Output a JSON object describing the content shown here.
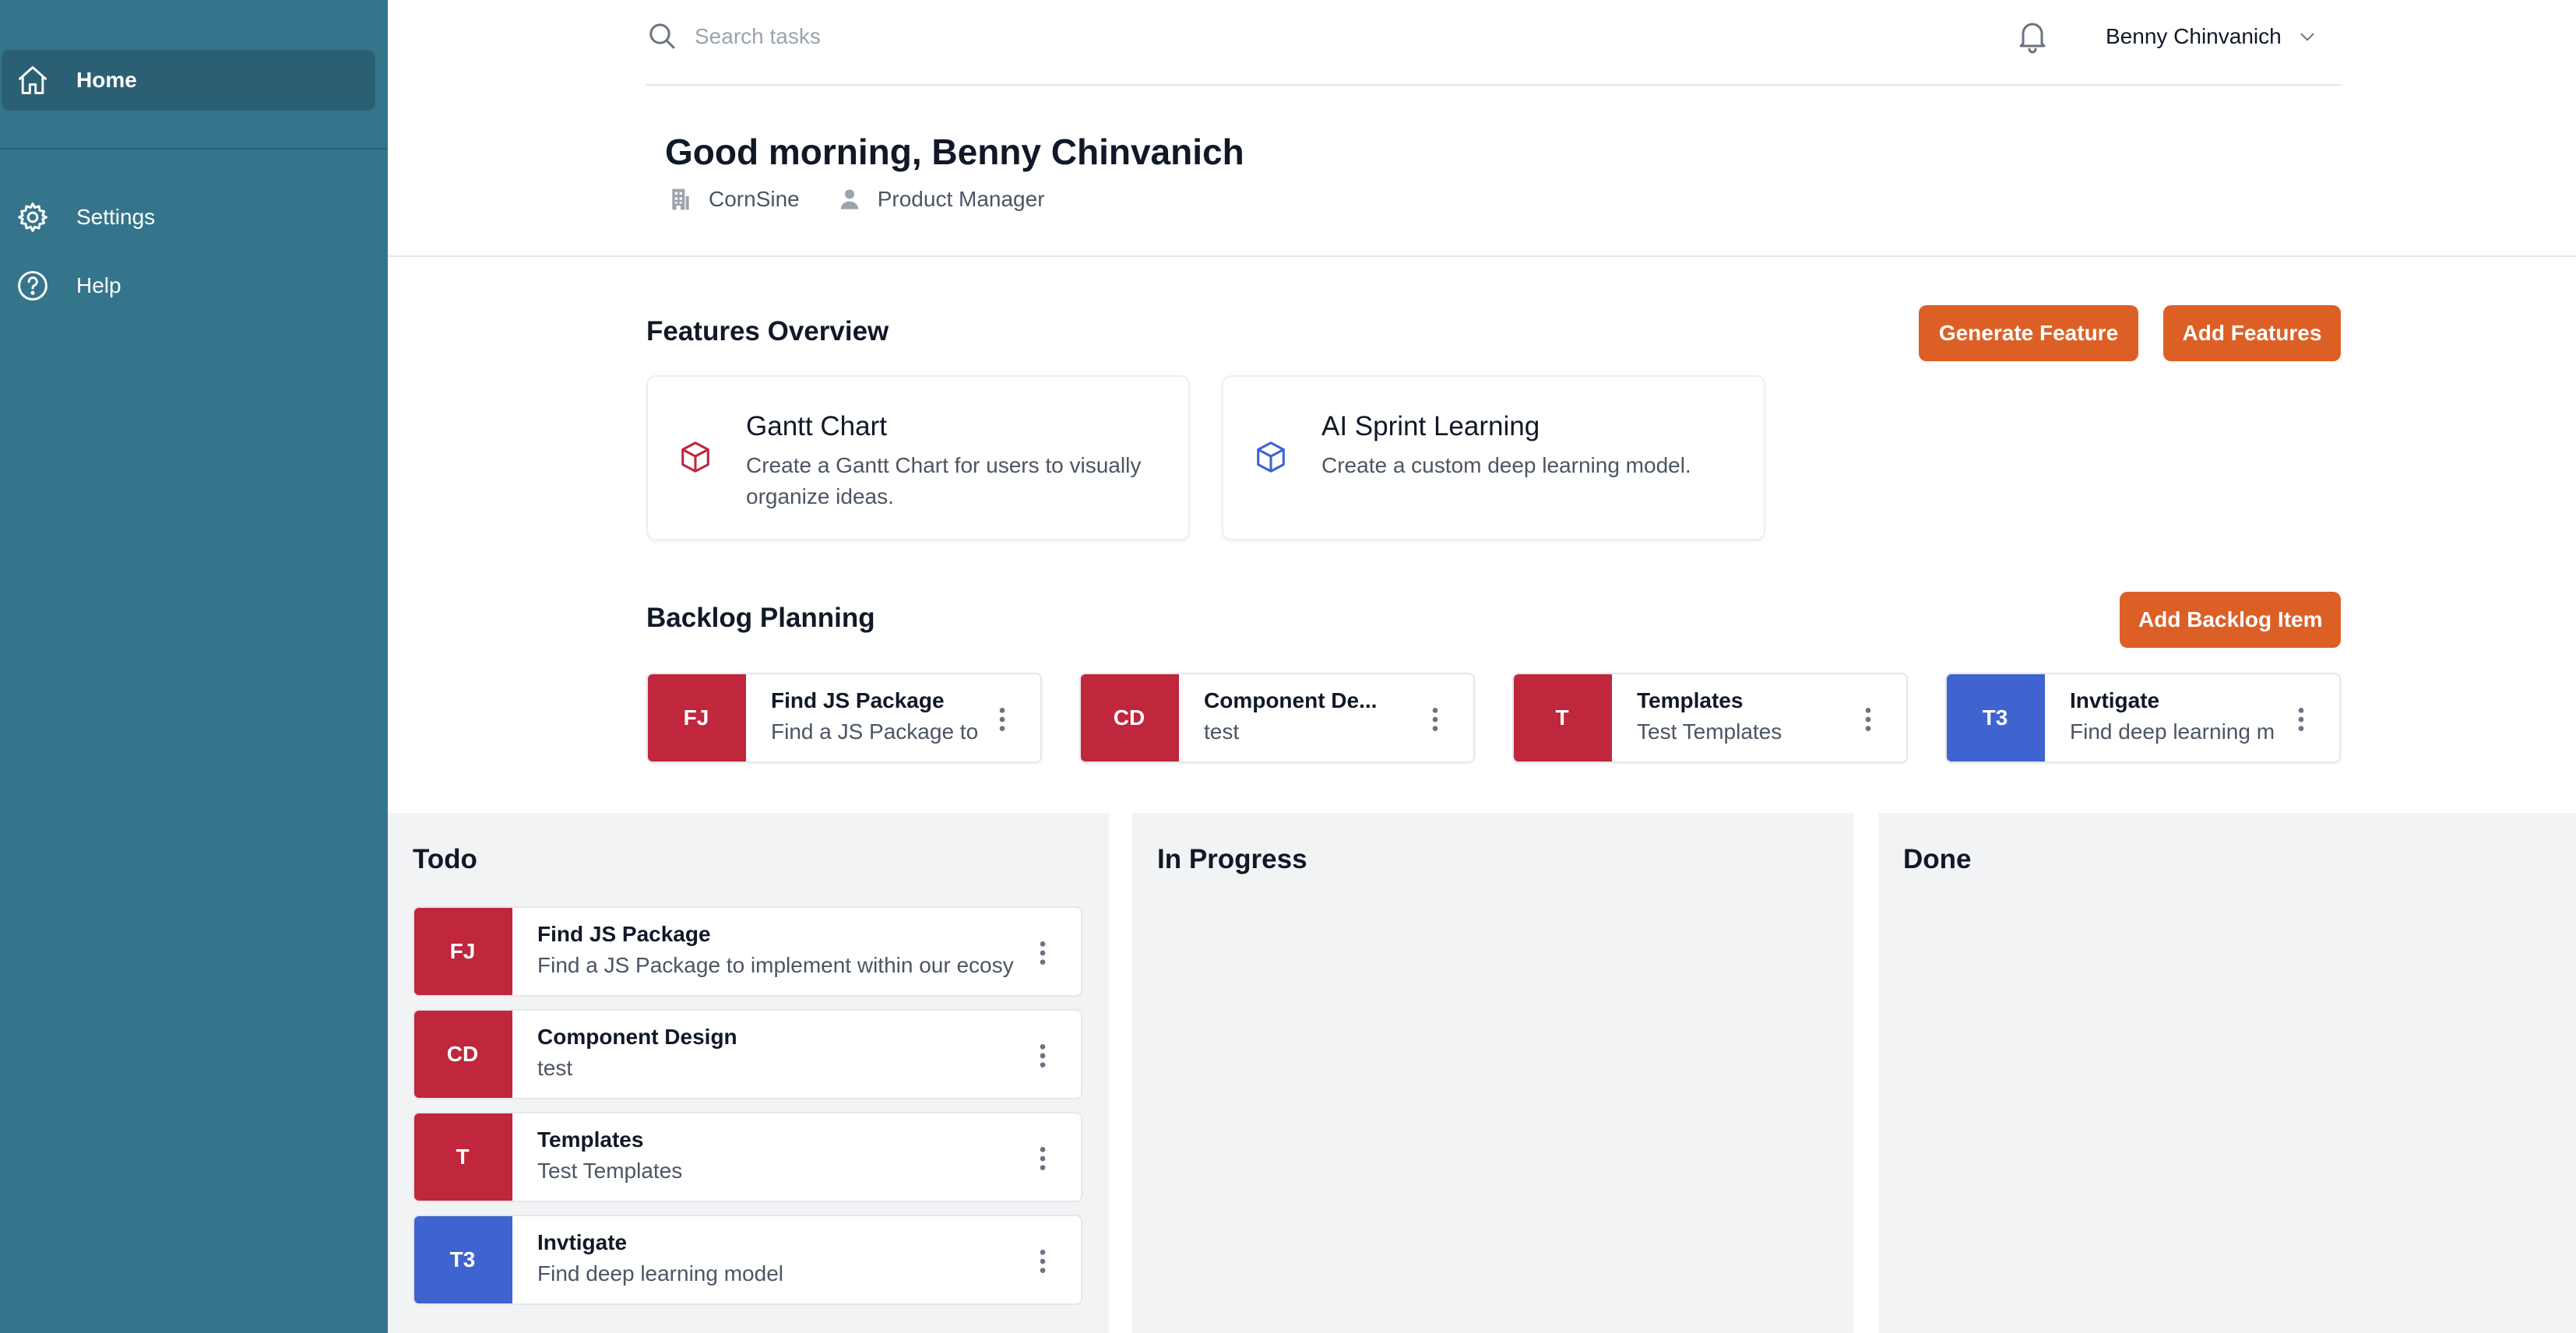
{
  "sidebar": {
    "items": [
      {
        "label": "Home",
        "icon": "home-icon",
        "active": true
      },
      {
        "label": "Settings",
        "icon": "gear-icon"
      },
      {
        "label": "Help",
        "icon": "help-icon"
      }
    ]
  },
  "topbar": {
    "search_placeholder": "Search tasks",
    "user_name": "Benny Chinvanich"
  },
  "greeting": {
    "title": "Good morning, Benny Chinvanich",
    "company": "CornSine",
    "role": "Product Manager"
  },
  "features": {
    "title": "Features Overview",
    "generate_label": "Generate Feature",
    "add_label": "Add Features",
    "cards": [
      {
        "title": "Gantt Chart",
        "description": "Create a Gantt Chart for users to visually organize ideas.",
        "icon": "cube-icon",
        "icon_color": "#c0263c"
      },
      {
        "title": "AI Sprint Learning",
        "description": "Create a custom deep learning model.",
        "icon": "cube-icon",
        "icon_color": "#3f63cf"
      }
    ]
  },
  "backlog": {
    "title": "Backlog Planning",
    "add_label": "Add Backlog Item",
    "items": [
      {
        "initials": "FJ",
        "title": "Find JS Package",
        "description": "Find a JS Package to",
        "color": "#c0263c"
      },
      {
        "initials": "CD",
        "title": "Component De...",
        "description": "test",
        "color": "#c0263c"
      },
      {
        "initials": "T",
        "title": "Templates",
        "description": "Test Templates",
        "color": "#c0263c"
      },
      {
        "initials": "T3",
        "title": "Invtigate",
        "description": "Find deep learning m",
        "color": "#3f63cf"
      }
    ]
  },
  "board": {
    "columns": [
      {
        "title": "Todo",
        "cards": [
          {
            "initials": "FJ",
            "title": "Find JS Package",
            "description": "Find a JS Package to implement within our ecosy",
            "color": "#c0263c"
          },
          {
            "initials": "CD",
            "title": "Component Design",
            "description": "test",
            "color": "#c0263c"
          },
          {
            "initials": "T",
            "title": "Templates",
            "description": "Test Templates",
            "color": "#c0263c"
          },
          {
            "initials": "T3",
            "title": "Invtigate",
            "description": "Find deep learning model",
            "color": "#3f63cf"
          }
        ]
      },
      {
        "title": "In Progress",
        "cards": []
      },
      {
        "title": "Done",
        "cards": []
      }
    ]
  },
  "colors": {
    "sidebar": "#35758c",
    "sidebar_active": "#2b5f73",
    "accent_button": "#dc6026",
    "badge_red": "#c0263c",
    "badge_blue": "#3f63cf",
    "board_bg": "#f2f3f5"
  }
}
